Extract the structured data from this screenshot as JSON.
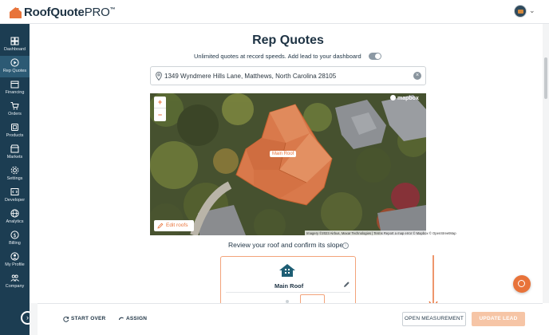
{
  "app": {
    "brand_main": "RoofQuote",
    "brand_pro": "PRO",
    "brand_tm": "™"
  },
  "sidebar": {
    "items": [
      {
        "label": "Dashboard",
        "icon": "dashboard-icon",
        "active": false
      },
      {
        "label": "Rep Quotes",
        "icon": "play-circle-icon",
        "active": true
      },
      {
        "label": "Financing",
        "icon": "calendar-icon",
        "active": false
      },
      {
        "label": "Orders",
        "icon": "cart-icon",
        "active": false
      },
      {
        "label": "Products",
        "icon": "products-icon",
        "active": false
      },
      {
        "label": "Markets",
        "icon": "store-icon",
        "active": false
      },
      {
        "label": "Settings",
        "icon": "gear-icon",
        "active": false
      },
      {
        "label": "Developer",
        "icon": "code-icon",
        "active": false
      },
      {
        "label": "Analytics",
        "icon": "globe-icon",
        "active": false
      },
      {
        "label": "Billing",
        "icon": "dollar-icon",
        "active": false
      },
      {
        "label": "My Profile",
        "icon": "user-icon",
        "active": false
      },
      {
        "label": "Company",
        "icon": "users-icon",
        "active": false
      }
    ],
    "toggle_glyph": "›"
  },
  "header": {
    "title": "Rep Quotes",
    "subtitle": "Unlimited quotes at record speeds. Add lead to your dashboard",
    "toggle_on": true
  },
  "search": {
    "address": "1349 Wyndmere Hills Lane, Matthews, North Carolina 28105",
    "clear_glyph": "×"
  },
  "map": {
    "zoom_in": "+",
    "zoom_out": "−",
    "provider": "mapbox",
    "roof_label": "Main Roof",
    "edit_roofs": "Edit roofs",
    "attribution": "Imagery ©2023 Airbus, Maxar Technologies | Terms    Report a map error",
    "mapbox_attr": "© Mapbox © OpenStreetMap"
  },
  "review": {
    "title": "Review your roof and confirm its slope",
    "info_glyph": "i",
    "roof_name": "Main Roof"
  },
  "footer": {
    "start_over": "START OVER",
    "assign": "ASSIGN",
    "open_measurement": "OPEN MEASUREMENT",
    "update_lead": "UPDATE LEAD"
  },
  "colors": {
    "accent": "#e8733a",
    "sidebar_bg": "#1c3d52",
    "sidebar_active": "#2c5a74",
    "text_dark": "#1e3344",
    "update_disabled": "#f6c5a6"
  }
}
